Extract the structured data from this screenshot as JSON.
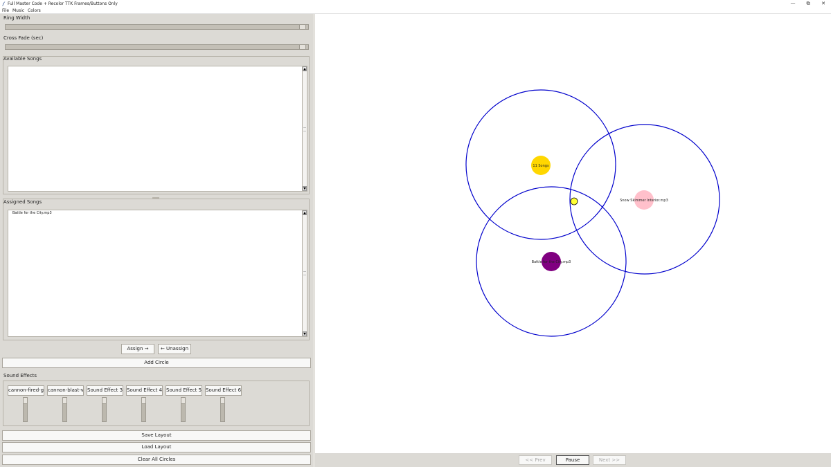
{
  "window": {
    "title": "Full Master Code + Recolor TTK Frames/Buttons Only",
    "controls": {
      "minimize": "—",
      "restore": "⧉",
      "close": "✕"
    }
  },
  "menu": [
    "File",
    "Music",
    "Colors"
  ],
  "left_panel": {
    "ring_width_label": "Ring Width",
    "ring_width_value": 1.0,
    "cross_fade_label": "Cross Fade (sec)",
    "cross_fade_value": 1.0,
    "available_songs_label": "Available Songs",
    "available_songs": [],
    "assigned_songs_label": "Assigned Songs",
    "assigned_songs": [
      "Battle for the City.mp3"
    ],
    "assign_button": "Assign →",
    "unassign_button": "← Unassign",
    "add_circle_button": "Add Circle",
    "sound_effects_label": "Sound Effects",
    "sound_effects": [
      {
        "label": "cannon-fired-g",
        "volume": 1.0
      },
      {
        "label": "cannon-blast-v",
        "volume": 1.0
      },
      {
        "label": "Sound Effect 3",
        "volume": 1.0
      },
      {
        "label": "Sound Effect 4",
        "volume": 1.0
      },
      {
        "label": "Sound Effect 5",
        "volume": 1.0
      },
      {
        "label": "Sound Effect 6",
        "volume": 1.0
      }
    ],
    "save_layout_button": "Save Layout",
    "load_layout_button": "Load Layout",
    "clear_circles_button": "Clear All Circles"
  },
  "canvas": {
    "ring_color": "#0000cc",
    "player_color": "#ffff33",
    "circles": [
      {
        "label": "11 Songs",
        "fill": "#ffd700"
      },
      {
        "label": "Snow Skimmer Interior.mp3",
        "fill": "#ffc0cb"
      },
      {
        "label": "Battle for the City.mp3",
        "fill": "#800080"
      }
    ]
  },
  "playback": {
    "prev_button": "<< Prev",
    "pause_button": "Pause",
    "next_button": "Next >>"
  },
  "colors": {
    "panel_bg": "#dcdad5",
    "canvas_bg": "#ffffff"
  }
}
